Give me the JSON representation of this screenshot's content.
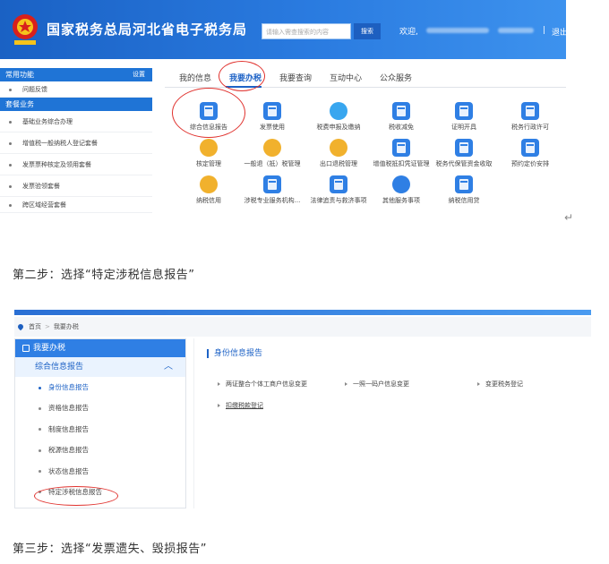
{
  "screenshot1": {
    "header": {
      "title": "国家税务总局河北省电子税务局",
      "search_placeholder": "请输入需查搜索的内容",
      "search_button": "搜索",
      "welcome": "欢迎,",
      "separator": "|",
      "logout": "退出"
    },
    "sidebar": {
      "frequent_title": "常用功能",
      "settings": "设置",
      "feedback": "问题反馈",
      "package_title": "套餐业务",
      "items": [
        "基础业务综合办理",
        "增值税一般纳税人登记套餐",
        "发票票种核定及领用套餐",
        "发票验领套餐",
        "跨区域经营套餐"
      ]
    },
    "tabs": [
      "我的信息",
      "我要办税",
      "我要查询",
      "互动中心",
      "公众服务"
    ],
    "active_tab": "我要办税",
    "grid": [
      [
        "综合信息报告",
        "发票使用",
        "税费申报及缴纳",
        "税收减免",
        "证明开具",
        "税务行政许可"
      ],
      [
        "核定管理",
        "一般退（抵）税管理",
        "出口退税管理",
        "增值税抵扣凭证管理",
        "税务代保管资金收取",
        "预约定价安排"
      ],
      [
        "纳税信用",
        "涉税专业服务机构...",
        "法律追责与救济事项",
        "其他服务事项",
        "纳税信用贷"
      ]
    ],
    "enter_mark": "↵"
  },
  "step2_text": "第二步：选择“特定涉税信息报告”",
  "screenshot2": {
    "breadcrumb": {
      "home": "首页",
      "current": "我要办税"
    },
    "sidebar": {
      "title": "我要办税",
      "group": "综合信息报告",
      "items": [
        "身份信息报告",
        "资格信息报告",
        "制度信息报告",
        "税源信息报告",
        "状态信息报告",
        "特定涉税信息报告"
      ]
    },
    "main": {
      "section_title": "身份信息报告",
      "links": [
        "两证整合个体工商户信息变更",
        "一照一码户信息变更",
        "变更税务登记",
        "扣缴税款登记"
      ]
    }
  },
  "step3_text": "第三步：选择“发票遗失、毁损报告”",
  "colors": {
    "header_blue": "#1a61c4",
    "accent_blue": "#1d62c6",
    "annotation_red": "#e0322e"
  }
}
